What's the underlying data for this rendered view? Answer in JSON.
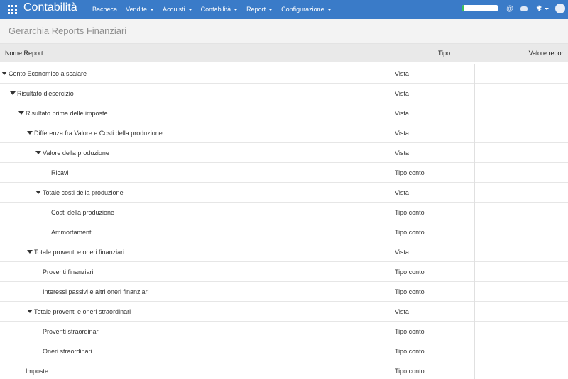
{
  "app": {
    "title": "Contabilità",
    "icon": "apps-grid-icon",
    "brand_color": "#3a7bc8"
  },
  "menu": [
    {
      "label": "Bacheca",
      "dropdown": false
    },
    {
      "label": "Vendite",
      "dropdown": true
    },
    {
      "label": "Acquisti",
      "dropdown": true
    },
    {
      "label": "Contabilità",
      "dropdown": true
    },
    {
      "label": "Report",
      "dropdown": true
    },
    {
      "label": "Configurazione",
      "dropdown": true
    }
  ],
  "toolbar_icons": [
    "at-sign-icon",
    "chat-icon",
    "gear-icon",
    "avatar"
  ],
  "toolbar": {
    "at_glyph": "@",
    "gear_glyph": "✱"
  },
  "breadcrumb": {
    "title": "Gerarchia Reports Finanziari"
  },
  "table": {
    "columns": {
      "name": "Nome Report",
      "type": "Tipo",
      "value": "Valore report"
    },
    "rows": [
      {
        "name": "Conto Economico a scalare",
        "type": "Vista",
        "level": 0,
        "expanded": true
      },
      {
        "name": "Risultato d'esercizio",
        "type": "Vista",
        "level": 1,
        "expanded": true
      },
      {
        "name": "Risultato prima delle imposte",
        "type": "Vista",
        "level": 2,
        "expanded": true
      },
      {
        "name": "Differenza fra Valore e Costi della produzione",
        "type": "Vista",
        "level": 3,
        "expanded": true
      },
      {
        "name": "Valore della produzione",
        "type": "Vista",
        "level": 4,
        "expanded": true
      },
      {
        "name": "Ricavi",
        "type": "Tipo conto",
        "level": 5,
        "expanded": false
      },
      {
        "name": "Totale costi della produzione",
        "type": "Vista",
        "level": 4,
        "expanded": true
      },
      {
        "name": "Costi della produzione",
        "type": "Tipo conto",
        "level": 5,
        "expanded": false
      },
      {
        "name": "Ammortamenti",
        "type": "Tipo conto",
        "level": 5,
        "expanded": false
      },
      {
        "name": "Totale proventi e oneri finanziari",
        "type": "Vista",
        "level": 3,
        "expanded": true
      },
      {
        "name": "Proventi finanziari",
        "type": "Tipo conto",
        "level": 4,
        "expanded": false
      },
      {
        "name": "Interessi passivi e altri oneri finanziari",
        "type": "Tipo conto",
        "level": 4,
        "expanded": false
      },
      {
        "name": "Totale proventi e oneri straordinari",
        "type": "Vista",
        "level": 3,
        "expanded": true
      },
      {
        "name": "Proventi straordinari",
        "type": "Tipo conto",
        "level": 4,
        "expanded": false
      },
      {
        "name": "Oneri straordinari",
        "type": "Tipo conto",
        "level": 4,
        "expanded": false
      },
      {
        "name": "Imposte",
        "type": "Tipo conto",
        "level": 2,
        "expanded": false
      }
    ]
  }
}
